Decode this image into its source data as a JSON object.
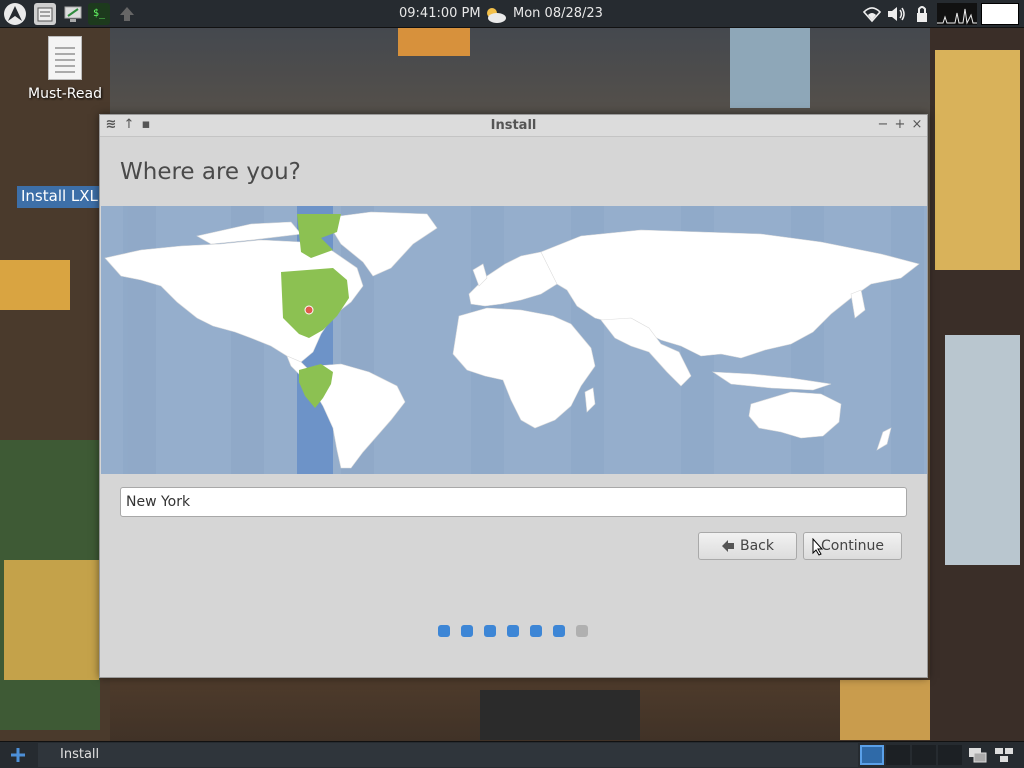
{
  "top_panel": {
    "clock": "09:41:00 PM",
    "date": "Mon 08/28/23",
    "icons": [
      "distro-logo-icon",
      "file-manager-icon",
      "monitor-icon",
      "terminal-icon",
      "update-arrow-icon",
      "weather-icon",
      "wifi-icon",
      "volume-icon",
      "lock-icon",
      "cpu-graph-icon",
      "blank-panel-box"
    ]
  },
  "desktop": {
    "icons": [
      {
        "label": "Must-Read",
        "icon": "document-icon"
      },
      {
        "label": "Install LXL",
        "icon": "installer-icon"
      }
    ]
  },
  "window": {
    "title": "Install",
    "heading": "Where are you?",
    "city_value": "New York",
    "back_label": "Back",
    "continue_label": "Continue",
    "progress": {
      "total": 7,
      "completed": 6
    },
    "colors": {
      "map_water": "#95aecc",
      "map_land": "#ffffff",
      "timezone_highlight": "#8cc152",
      "accent": "#3d86d6"
    }
  },
  "taskbar": {
    "task_label": "Install"
  }
}
